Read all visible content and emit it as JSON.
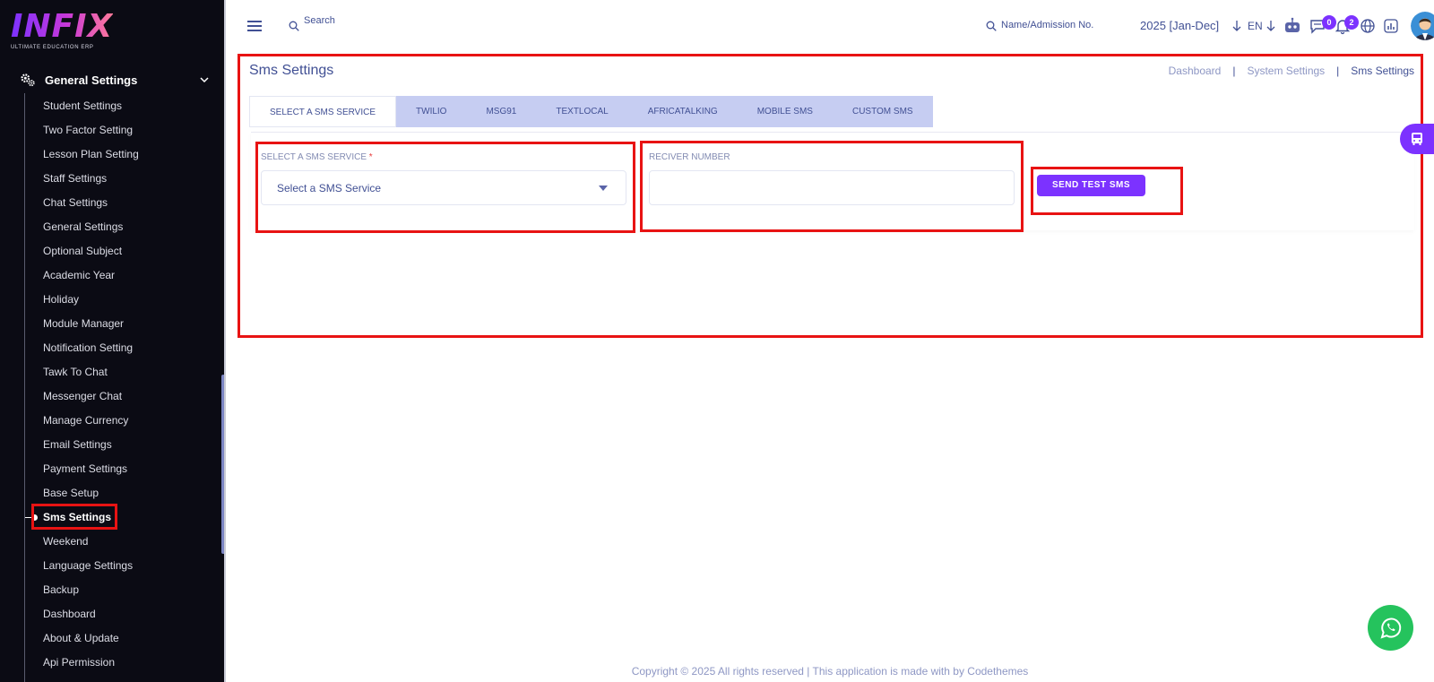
{
  "logo": {
    "word": "INFIX",
    "subtitle": "ULTIMATE EDUCATION ERP"
  },
  "sidebar": {
    "group_label": "General Settings",
    "items": [
      "Student Settings",
      "Two Factor Setting",
      "Lesson Plan Setting",
      "Staff Settings",
      "Chat Settings",
      "General Settings",
      "Optional Subject",
      "Academic Year",
      "Holiday",
      "Module Manager",
      "Notification Setting",
      "Tawk To Chat",
      "Messenger Chat",
      "Manage Currency",
      "Email Settings",
      "Payment Settings",
      "Base Setup",
      "Sms Settings",
      "Weekend",
      "Language Settings",
      "Backup",
      "Dashboard",
      "About & Update",
      "Api Permission"
    ],
    "active_item": "Sms Settings"
  },
  "topbar": {
    "search_label": "Search",
    "admission_search_label": "Name/Admission No.",
    "session": "2025 [Jan-Dec]",
    "language": "EN",
    "message_count": "0",
    "notification_count": "2",
    "icons": [
      "menu-icon",
      "search-icon",
      "robot-icon",
      "chat-icon",
      "bell-icon",
      "globe-icon",
      "report-icon",
      "avatar"
    ]
  },
  "page": {
    "title": "Sms Settings",
    "breadcrumb": [
      "Dashboard",
      "System Settings",
      "Sms Settings"
    ],
    "breadcrumb_sep": "|"
  },
  "tabs": [
    "SELECT A SMS SERVICE",
    "TWILIO",
    "MSG91",
    "TEXTLOCAL",
    "AFRICATALKING",
    "MOBILE SMS",
    "CUSTOM SMS"
  ],
  "form": {
    "service_label": "SELECT A SMS SERVICE",
    "required_mark": "*",
    "service_placeholder": "Select a SMS Service",
    "receiver_label": "RECIVER NUMBER",
    "receiver_value": "",
    "send_button": "SEND TEST SMS"
  },
  "footer": "Copyright © 2025 All rights reserved | This application is made with by Codethemes",
  "colors": {
    "sidebar_bg": "#0b0b14",
    "accent": "#7c32ff",
    "tab_bg": "#c6cdf2",
    "text": "#415094",
    "highlight": "#e81313",
    "whatsapp": "#25c35d"
  }
}
